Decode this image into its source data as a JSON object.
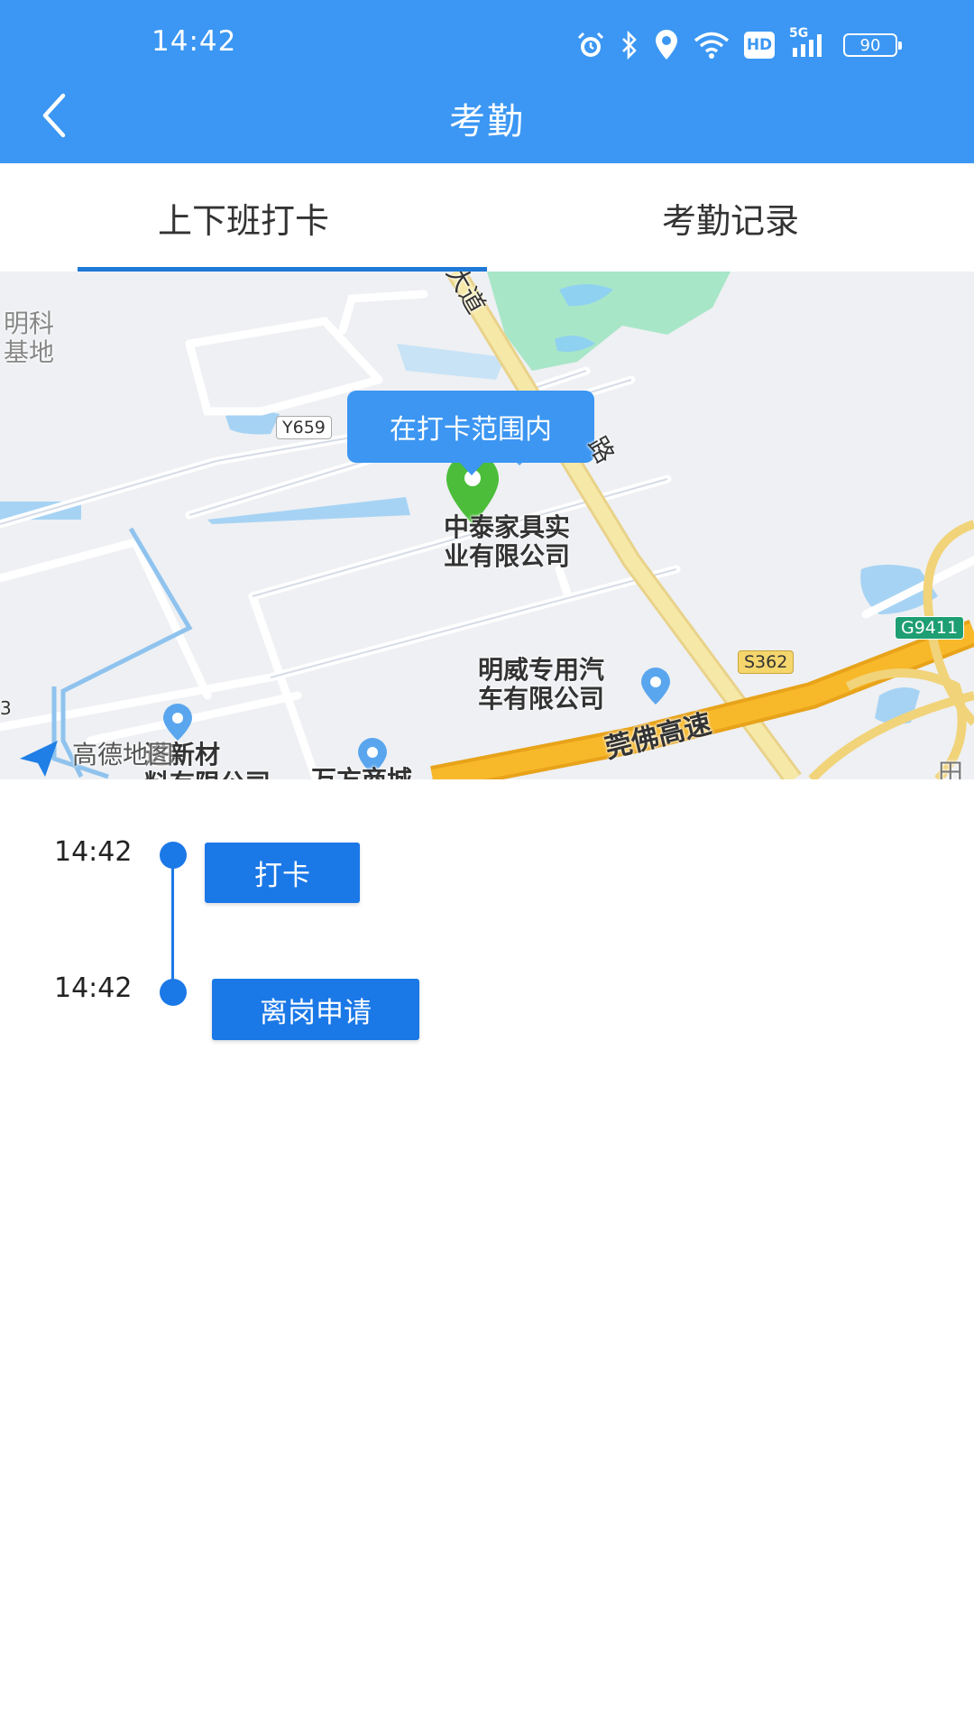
{
  "status_bar": {
    "time": "14:42",
    "hd": "HD",
    "signal": "5G",
    "battery": "90",
    "icons": [
      "alarm-icon",
      "bluetooth-icon",
      "location-icon",
      "wifi-icon",
      "hd-icon",
      "signal-icon",
      "battery-icon"
    ]
  },
  "header": {
    "title": "考勤",
    "back_icon": "chevron-left-icon"
  },
  "tabs": [
    {
      "label": "上下班打卡",
      "active": true
    },
    {
      "label": "考勤记录",
      "active": false
    }
  ],
  "map": {
    "range_status": "在打卡范围内",
    "watermark": "高德地图",
    "labels": {
      "mingke": "明科\n基地",
      "zhongtai": "中泰家具实\n业有限公司",
      "mingwei": "明威专用汽\n车有限公司",
      "jinxin": "进新材\n料有限公司",
      "wanfang": "万方商城",
      "expressway": "莞佛高速",
      "avenue_a": "大道",
      "avenue_b": "路",
      "edge_left": "3",
      "edge_right": "田"
    },
    "shields": {
      "y659": "Y659",
      "s362": "S362",
      "g9411": "G9411"
    }
  },
  "timeline": [
    {
      "time": "14:42",
      "action": "打卡"
    },
    {
      "time": "14:42",
      "action": "离岗申请"
    }
  ],
  "colors": {
    "primary": "#3b97f3",
    "accent": "#1b78e7"
  }
}
